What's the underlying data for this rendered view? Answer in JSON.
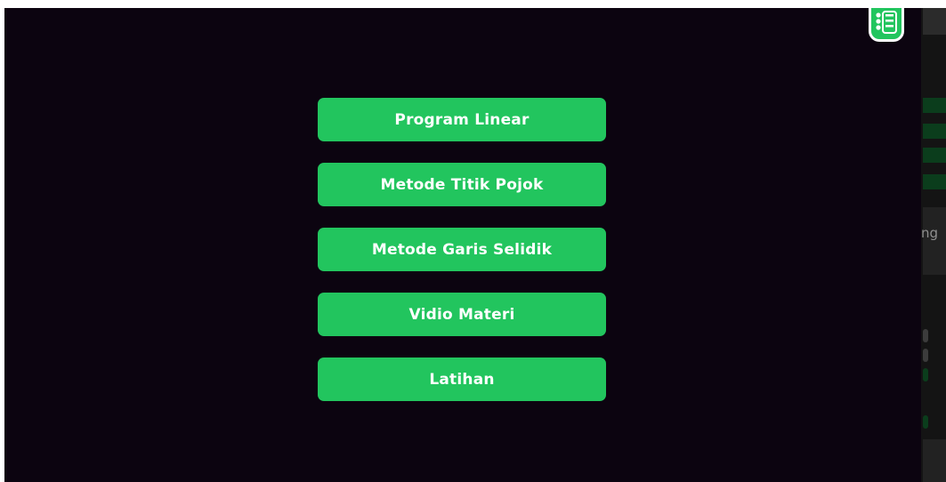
{
  "menu": {
    "items": [
      {
        "label": "Program Linear"
      },
      {
        "label": "Metode Titik Pojok"
      },
      {
        "label": "Metode Garis Selidik"
      },
      {
        "label": "Vidio Materi"
      },
      {
        "label": "Latihan"
      }
    ]
  },
  "background_app": {
    "partial_text": "ng"
  },
  "icons": {
    "menu": "list-menu-icon"
  },
  "colors": {
    "button": "#22c55e",
    "button_text": "#ffffff",
    "overlay": "#0c0410"
  }
}
